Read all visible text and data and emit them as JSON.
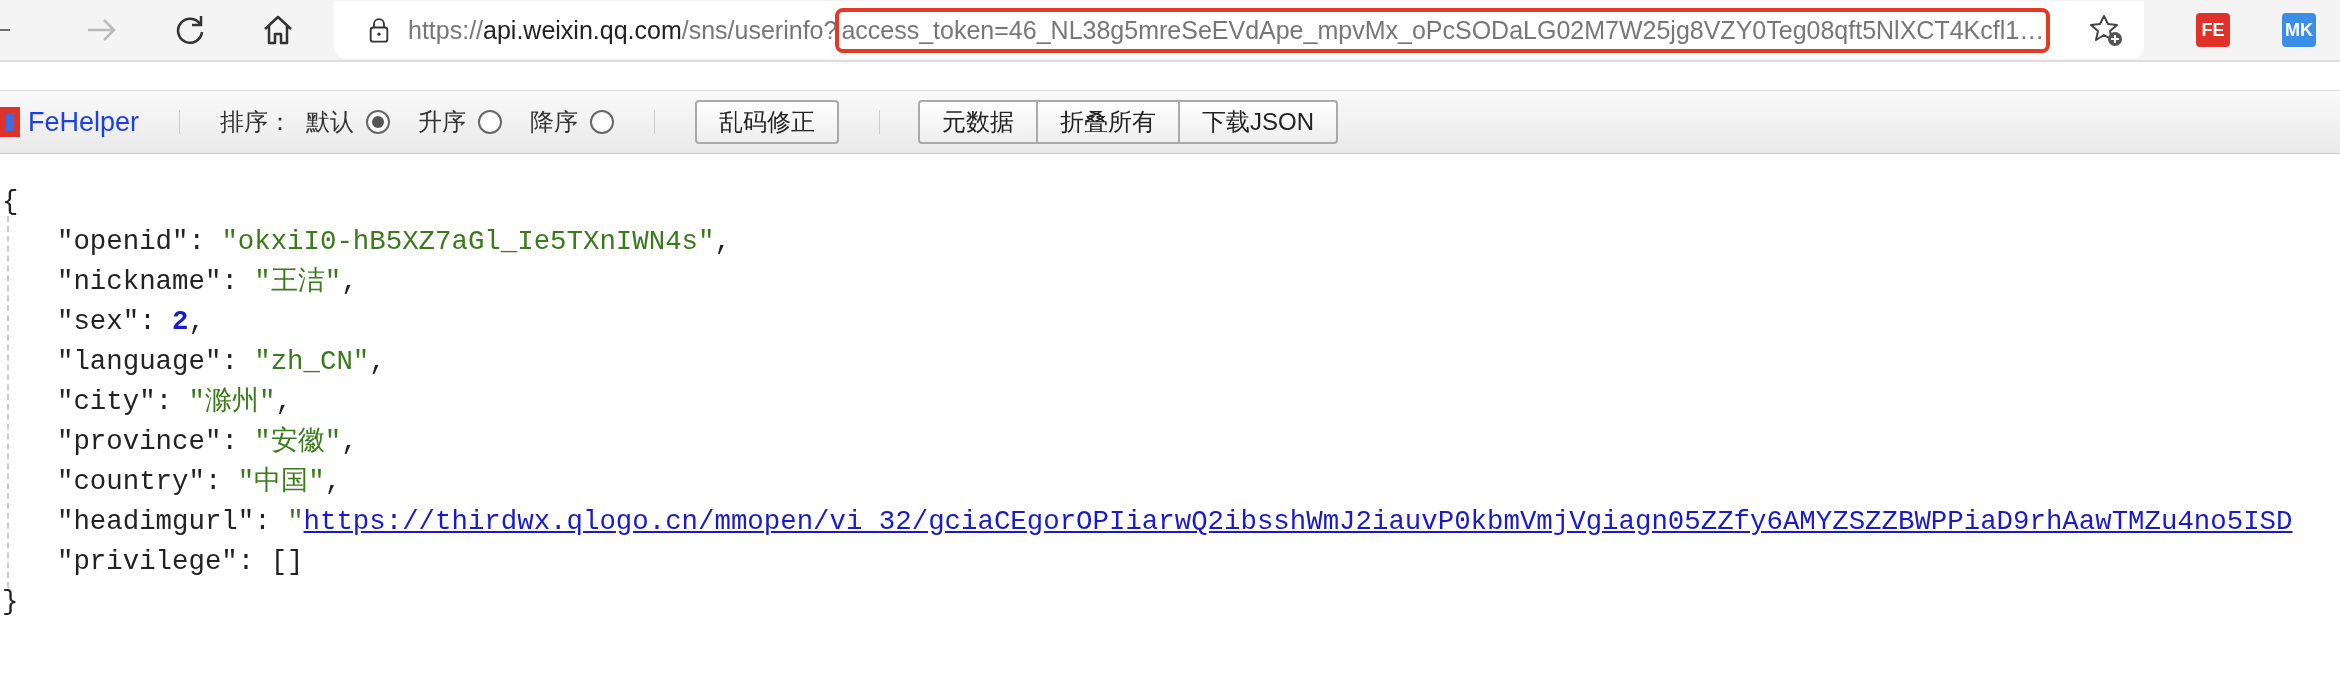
{
  "browser": {
    "url": {
      "scheme": "https://",
      "host": "api.weixin.qq.com",
      "path": "/sns/userinfo?",
      "query": "access_token=46_NL38g5mreSeEVdApe_mpvMx_oPcSODaLG02M7W25jg8VZY0Teg08qft5NlXCT4Kcfl1…",
      "query_highlighted": true
    },
    "extensions": [
      {
        "label": "FE",
        "color": "#e0312b"
      },
      {
        "label": "MK",
        "color": "#3a8ee6"
      }
    ]
  },
  "fehelper": {
    "title": "FeHelper",
    "sort_label": "排序：",
    "sort_options": [
      {
        "label": "默认",
        "selected": true
      },
      {
        "label": "升序",
        "selected": false
      },
      {
        "label": "降序",
        "selected": false
      }
    ],
    "fix_button": "乱码修正",
    "buttons": [
      "元数据",
      "折叠所有",
      "下载JSON"
    ]
  },
  "json": {
    "open": "{",
    "close": "}",
    "entries": [
      {
        "key": "\"openid\"",
        "colon": ":",
        "kind": "string",
        "value": "\"okxiI0-hB5XZ7aGl_Ie5TXnIWN4s\"",
        "comma": ","
      },
      {
        "key": "\"nickname\"",
        "colon": ":",
        "kind": "string",
        "value": "\"王洁\"",
        "comma": ","
      },
      {
        "key": "\"sex\"",
        "colon": ":",
        "kind": "number",
        "value": "2",
        "comma": ","
      },
      {
        "key": "\"language\"",
        "colon": ":",
        "kind": "string",
        "value": "\"zh_CN\"",
        "comma": ","
      },
      {
        "key": "\"city\"",
        "colon": ":",
        "kind": "string",
        "value": "\"滁州\"",
        "comma": ","
      },
      {
        "key": "\"province\"",
        "colon": ":",
        "kind": "string",
        "value": "\"安徽\"",
        "comma": ","
      },
      {
        "key": "\"country\"",
        "colon": ":",
        "kind": "string",
        "value": "\"中国\"",
        "comma": ","
      },
      {
        "key": "\"headimgurl\"",
        "colon": ":",
        "kind": "link",
        "quote": "\"",
        "value": "https://thirdwx.qlogo.cn/mmopen/vi_32/gciaCEgorOPIiarwQ2ibsshWmJ2iauvP0kbmVmjVgiagn05ZZfy6AMYZSZZBWPPiaD9rhAawTMZu4no5ISD"
      },
      {
        "key": "\"privilege\"",
        "colon": ":",
        "kind": "array",
        "value": "[]"
      }
    ]
  }
}
